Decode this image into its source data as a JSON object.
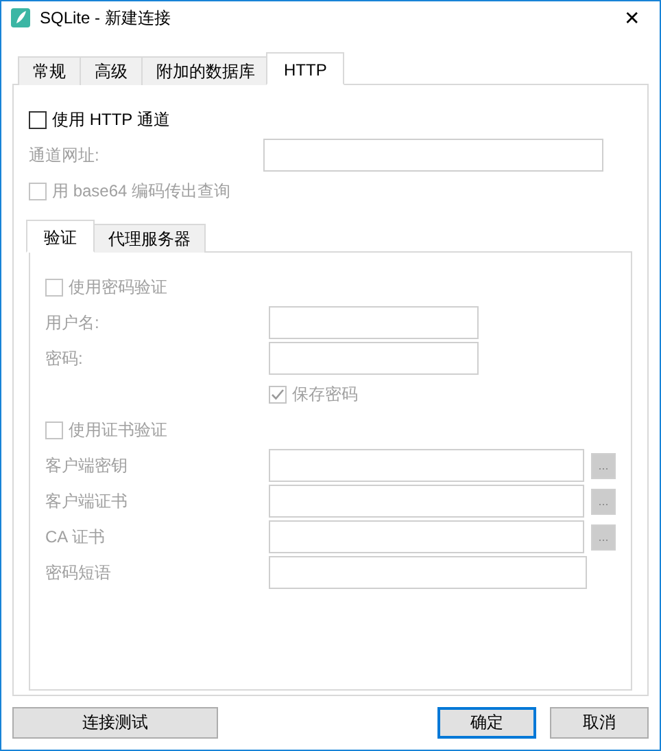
{
  "window": {
    "title": "SQLite - 新建连接",
    "close": "✕"
  },
  "tabs": [
    {
      "label": "常规",
      "selected": false
    },
    {
      "label": "高级",
      "selected": false
    },
    {
      "label": "附加的数据库",
      "selected": false
    },
    {
      "label": "HTTP",
      "selected": true
    }
  ],
  "http": [
    {
      "kind": "checkbox",
      "label": "使用 HTTP 通道",
      "checked": false,
      "disabled": false
    },
    {
      "kind": "field",
      "label": "通道网址:",
      "disabled": true
    },
    {
      "kind": "checkbox",
      "label": "用 base64 编码传出查询",
      "checked": false,
      "disabled": true
    }
  ],
  "sub_tabs": [
    {
      "label": "验证",
      "selected": true
    },
    {
      "label": "代理服务器",
      "selected": false
    }
  ],
  "auth": [
    {
      "kind": "checkbox",
      "label": "使用密码验证",
      "checked": false,
      "disabled": true
    },
    {
      "kind": "field",
      "label": "用户名:",
      "disabled": true
    },
    {
      "kind": "field",
      "label": "密码:",
      "disabled": true
    },
    {
      "kind": "subcheck",
      "label": "保存密码",
      "checked": true,
      "disabled": true
    },
    {
      "kind": "checkbox",
      "label": "使用证书验证",
      "checked": false,
      "disabled": true
    },
    {
      "kind": "field",
      "label": "客户端密钥",
      "disabled": true,
      "browse": "..."
    },
    {
      "kind": "field",
      "label": "客户端证书",
      "disabled": true,
      "browse": "..."
    },
    {
      "kind": "field",
      "label": "CA 证书",
      "disabled": true,
      "browse": "..."
    },
    {
      "kind": "field",
      "label": "密码短语",
      "disabled": true
    }
  ],
  "buttons": [
    {
      "label": "连接测试",
      "default": false
    },
    {
      "label": "确定",
      "default": true
    },
    {
      "label": "取消",
      "default": false
    }
  ]
}
